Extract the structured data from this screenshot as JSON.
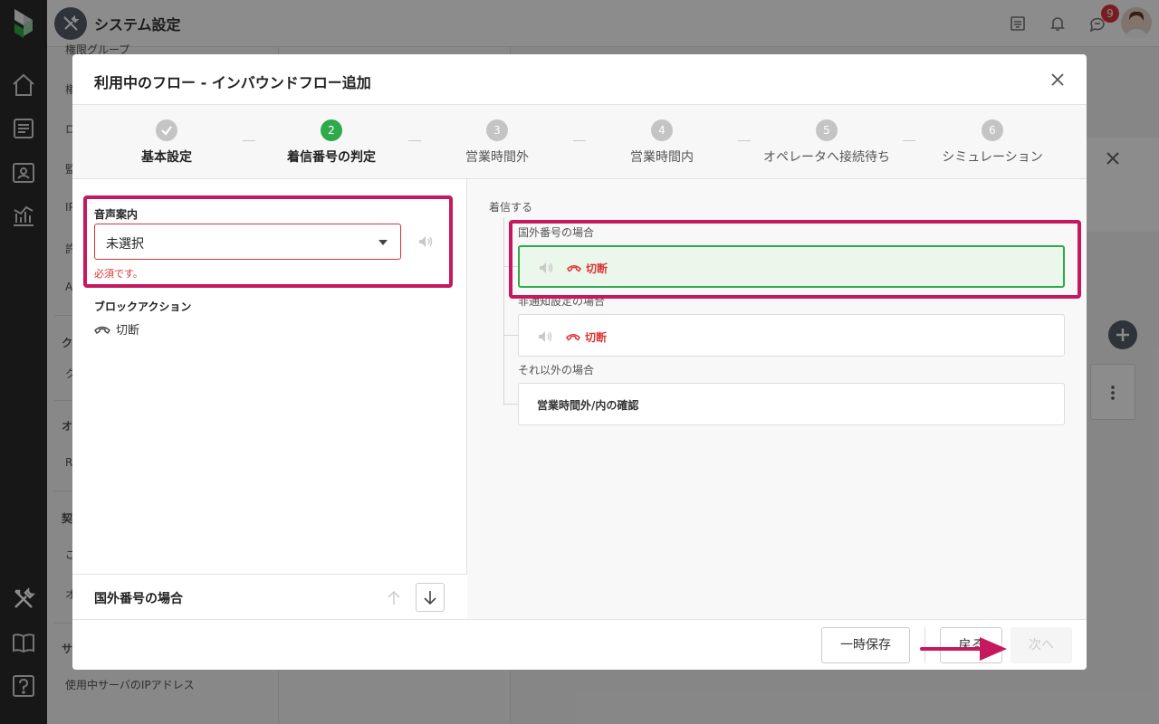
{
  "app": {
    "title": "システム設定",
    "notification_count": "9"
  },
  "settings_menu": {
    "items": [
      {
        "label": "権限グループ"
      },
      {
        "label": "権"
      },
      {
        "label": "ロ"
      },
      {
        "label": "監"
      },
      {
        "label": "IP"
      },
      {
        "label": "許"
      },
      {
        "label": "A"
      },
      {
        "label": "ク"
      },
      {
        "label": "ク"
      },
      {
        "label": "オ"
      },
      {
        "label": "R"
      },
      {
        "label": "契"
      },
      {
        "label": "ご"
      },
      {
        "label": "オ"
      },
      {
        "label": "サ"
      },
      {
        "label": "使用中サーバのIPアドレス"
      }
    ]
  },
  "modal": {
    "title": "利用中のフロー - インバウンドフロー追加",
    "steps": [
      {
        "number": "1",
        "label": "基本設定",
        "state": "done"
      },
      {
        "number": "2",
        "label": "着信番号の判定",
        "state": "active"
      },
      {
        "number": "3",
        "label": "営業時間外",
        "state": "pending"
      },
      {
        "number": "4",
        "label": "営業時間内",
        "state": "pending"
      },
      {
        "number": "5",
        "label": "オペレータへ接続待ち",
        "state": "pending"
      },
      {
        "number": "6",
        "label": "シミュレーション",
        "state": "pending"
      }
    ],
    "left": {
      "voice_label": "音声案内",
      "voice_value": "未選択",
      "error": "必須です。",
      "block_action_label": "ブロックアクション",
      "block_action_value": "切断",
      "footer_title": "国外番号の場合"
    },
    "right": {
      "root": "着信する",
      "branches": [
        {
          "label": "国外番号の場合",
          "action": "切断",
          "selected": true
        },
        {
          "label": "非通知設定の場合",
          "action": "切断",
          "selected": false
        },
        {
          "label": "それ以外の場合",
          "action": "営業時間外/内の確認",
          "selected": false
        }
      ]
    },
    "footer": {
      "temp_save": "一時保存",
      "back": "戻る",
      "next": "次へ"
    }
  },
  "colors": {
    "accent_green": "#2eaa4a",
    "error_red": "#dd3333",
    "highlight": "#c6185f"
  }
}
